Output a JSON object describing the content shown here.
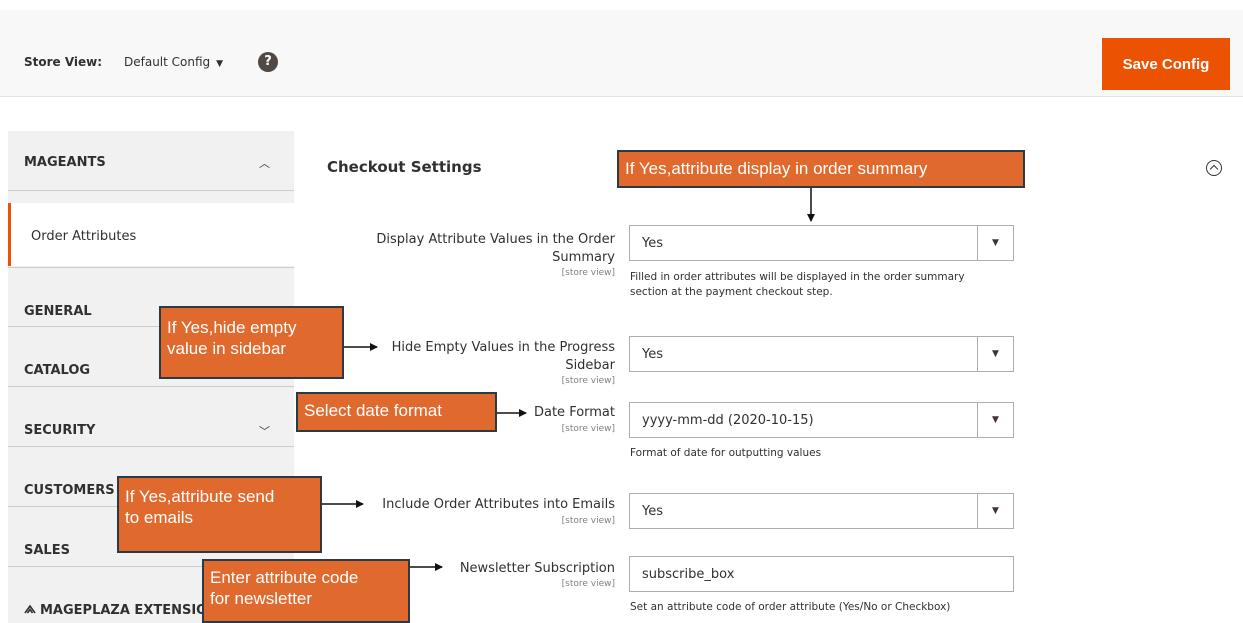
{
  "topbar": {
    "store_view_label": "Store View:",
    "store_view_value": "Default Config",
    "help_glyph": "?",
    "save_label": "Save Config"
  },
  "colors": {
    "accent": "#eb5202",
    "callout": "#e06a2e",
    "callout_border": "#2b3a44"
  },
  "sidebar": {
    "mageants": "MAGEANTS",
    "order_attributes": "Order Attributes",
    "general": "GENERAL",
    "catalog": "CATALOG",
    "security": "SECURITY",
    "customers": "CUSTOMERS",
    "sales": "SALES",
    "mageplaza": "MAGEPLAZA EXTENSIO"
  },
  "main": {
    "section_title": "Checkout Settings",
    "fields": [
      {
        "label_l1": "Display Attribute Values in the Order",
        "label_l2": "Summary",
        "scope": "[store view]",
        "value": "Yes",
        "note_l1": "Filled in order attributes will be displayed in the order summary",
        "note_l2": "section at the payment checkout step."
      },
      {
        "label_l1": "Hide Empty Values in the Progress",
        "label_l2": "Sidebar",
        "scope": "[store view]",
        "value": "Yes"
      },
      {
        "label_l1": "Date Format",
        "scope": "[store view]",
        "value": "yyyy-mm-dd (2020-10-15)",
        "note_l1": "Format of date for outputting values"
      },
      {
        "label_l1": "Include Order Attributes into Emails",
        "scope": "[store view]",
        "value": "Yes"
      },
      {
        "label_l1": "Newsletter Subscription",
        "scope": "[store view]",
        "value": "subscribe_box",
        "note_l1": "Set an attribute code of order attribute (Yes/No or Checkbox)"
      }
    ]
  },
  "callouts": {
    "c1": "If Yes,attribute display in order summary",
    "c2_l1": "If Yes,hide empty",
    "c2_l2": "value in sidebar",
    "c3": "Select date format",
    "c4_l1": "If Yes,attribute send",
    "c4_l2": "to emails",
    "c5_l1": "Enter attribute code",
    "c5_l2": "for newsletter"
  }
}
